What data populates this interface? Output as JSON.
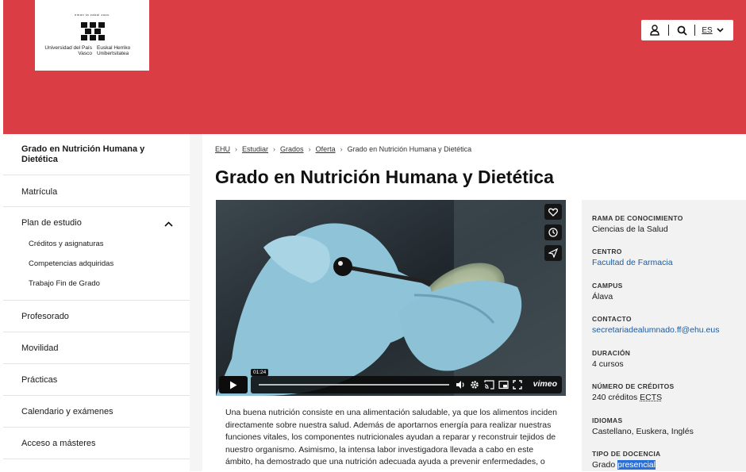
{
  "header": {
    "logo_top": "eman ta zabal zazu",
    "logo_left": "Universidad del País Vasco",
    "logo_right": "Euskal Herriko Unibertsitatea",
    "lang": "ES",
    "brand_color": "#da3d44"
  },
  "sidebar": {
    "title": "Grado en Nutrición Humana y Dietética",
    "items": [
      {
        "label": "Matrícula"
      },
      {
        "label": "Plan de estudio"
      },
      {
        "label": "Profesorado"
      },
      {
        "label": "Movilidad"
      },
      {
        "label": "Prácticas"
      },
      {
        "label": "Calendario y exámenes"
      },
      {
        "label": "Acceso a másteres"
      }
    ],
    "subitems": [
      {
        "label": "Créditos y asignaturas"
      },
      {
        "label": "Competencias adquiridas"
      },
      {
        "label": "Trabajo Fin de Grado"
      }
    ]
  },
  "breadcrumb": [
    "EHU",
    "Estudiar",
    "Grados",
    "Oferta",
    "Grado en Nutrición Humana y Dietética"
  ],
  "page_title": "Grado en Nutrición Humana y Dietética",
  "video": {
    "time": "01:24",
    "brand": "vimeo"
  },
  "body_text": "Una buena nutrición consiste en una alimentación saludable, ya que los alimentos inciden directamente sobre nuestra salud. Además de aportarnos energía para realizar nuestras funciones vitales, los componentes nutricionales ayudan a reparar y reconstruir tejidos de nuestro organismo. Asimismo, la intensa labor investigadora llevada a cabo en este ámbito, ha demostrado que una nutrición adecuada ayuda a prevenir enfermedades, o",
  "info": {
    "rama_label": "RAMA DE CONOCIMIENTO",
    "rama_value": "Ciencias de la Salud",
    "centro_label": "CENTRO",
    "centro_value": "Facultad de Farmacia",
    "campus_label": "CAMPUS",
    "campus_value": "Álava",
    "contacto_label": "CONTACTO",
    "contacto_value": "secretariadealumnado.ff@ehu.eus",
    "duracion_label": "DURACIÓN",
    "duracion_value": "4 cursos",
    "creditos_label": "NÚMERO DE CRÉDITOS",
    "creditos_prefix": "240 créditos",
    "creditos_unit": "ECTS",
    "idiomas_label": "IDIOMAS",
    "idiomas_value": "Castellano, Euskera, Inglés",
    "docencia_label": "TIPO DE DOCENCIA",
    "docencia_prefix": "Grado",
    "docencia_selected": "presencial"
  }
}
